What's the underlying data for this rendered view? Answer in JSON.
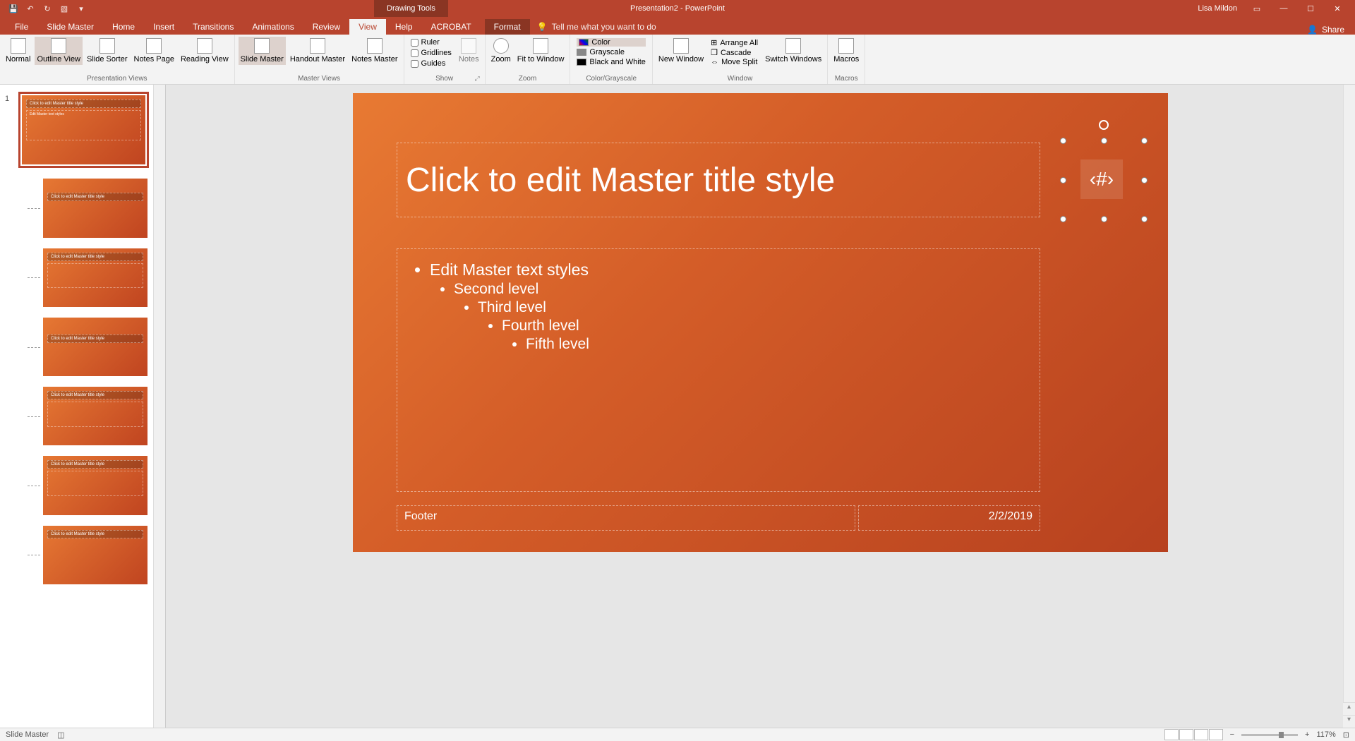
{
  "titlebar": {
    "context_tool": "Drawing Tools",
    "doc_title": "Presentation2 - PowerPoint",
    "user": "Lisa Mildon"
  },
  "tabs": [
    "File",
    "Slide Master",
    "Home",
    "Insert",
    "Transitions",
    "Animations",
    "Review",
    "View",
    "Help",
    "ACROBAT",
    "Format"
  ],
  "active_tab": "View",
  "tell_me": "Tell me what you want to do",
  "share": "Share",
  "ribbon": {
    "presentation_views": {
      "label": "Presentation Views",
      "items": [
        "Normal",
        "Outline View",
        "Slide Sorter",
        "Notes Page",
        "Reading View"
      ]
    },
    "master_views": {
      "label": "Master Views",
      "items": [
        "Slide Master",
        "Handout Master",
        "Notes Master"
      ]
    },
    "show": {
      "label": "Show",
      "items": [
        "Ruler",
        "Gridlines",
        "Guides"
      ],
      "notes": "Notes"
    },
    "zoom": {
      "label": "Zoom",
      "zoom": "Zoom",
      "fit": "Fit to Window"
    },
    "color": {
      "label": "Color/Grayscale",
      "color": "Color",
      "gray": "Grayscale",
      "bw": "Black and White"
    },
    "window": {
      "label": "Window",
      "new": "New Window",
      "switch": "Switch Windows",
      "arrange": "Arrange All",
      "cascade": "Cascade",
      "split": "Move Split"
    },
    "macros": {
      "label": "Macros",
      "btn": "Macros"
    }
  },
  "slide": {
    "title_ph": "Click to edit Master title style",
    "body_l1": "Edit Master text styles",
    "body_l2": "Second level",
    "body_l3": "Third level",
    "body_l4": "Fourth level",
    "body_l5": "Fifth level",
    "footer": "Footer",
    "date": "2/2/2019",
    "num": "‹#›"
  },
  "thumbs": {
    "master_num": "1",
    "master_title": "Click to edit Master title style",
    "master_body": "Edit Master text styles",
    "layout_title": "Click to edit Master title style"
  },
  "status": {
    "mode": "Slide Master",
    "zoom": "117%"
  }
}
